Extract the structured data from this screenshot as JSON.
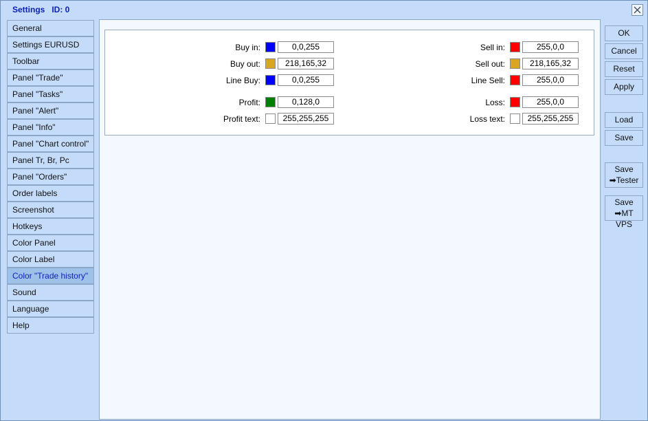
{
  "window": {
    "title": "Settings   ID: 0"
  },
  "sidebar": {
    "items": [
      {
        "label": "General"
      },
      {
        "label": "Settings EURUSD"
      },
      {
        "label": "Toolbar"
      },
      {
        "label": "Panel \"Trade\""
      },
      {
        "label": "Panel \"Tasks\""
      },
      {
        "label": "Panel \"Alert\""
      },
      {
        "label": "Panel \"Info\""
      },
      {
        "label": "Panel \"Chart control\""
      },
      {
        "label": "Panel Tr, Br, Pc"
      },
      {
        "label": "Panel \"Orders\""
      },
      {
        "label": "Order labels"
      },
      {
        "label": "Screenshot"
      },
      {
        "label": "Hotkeys"
      },
      {
        "label": "Color Panel"
      },
      {
        "label": "Color Label"
      },
      {
        "label": "Color \"Trade history\""
      },
      {
        "label": "Sound"
      },
      {
        "label": "Language"
      },
      {
        "label": "Help"
      }
    ],
    "active_index": 15
  },
  "colors": {
    "left": [
      {
        "label": "Buy in:",
        "swatch": "#0000ff",
        "value": "0,0,255"
      },
      {
        "label": "Buy out:",
        "swatch": "#daa520",
        "value": "218,165,32"
      },
      {
        "label": "Line Buy:",
        "swatch": "#0000ff",
        "value": "0,0,255"
      },
      {
        "label": "Profit:",
        "swatch": "#008000",
        "value": "0,128,0"
      },
      {
        "label": "Profit text:",
        "swatch": "#ffffff",
        "value": "255,255,255"
      }
    ],
    "right": [
      {
        "label": "Sell in:",
        "swatch": "#ff0000",
        "value": "255,0,0"
      },
      {
        "label": "Sell out:",
        "swatch": "#daa520",
        "value": "218,165,32"
      },
      {
        "label": "Line Sell:",
        "swatch": "#ff0000",
        "value": "255,0,0"
      },
      {
        "label": "Loss:",
        "swatch": "#ff0000",
        "value": "255,0,0"
      },
      {
        "label": "Loss text:",
        "swatch": "#ffffff",
        "value": "255,255,255"
      }
    ]
  },
  "buttons": {
    "ok": "OK",
    "cancel": "Cancel",
    "reset": "Reset",
    "apply": "Apply",
    "load": "Load",
    "save": "Save",
    "save_tester_1": "Save",
    "save_tester_2": "➡Tester",
    "save_vps_1": "Save",
    "save_vps_2": "➡MT VPS"
  },
  "icons": {
    "close": "close-icon"
  },
  "theme": {
    "accent": "#0a1fb5",
    "panel": "#c4dcfa",
    "active_item": "#9ec1ea"
  }
}
